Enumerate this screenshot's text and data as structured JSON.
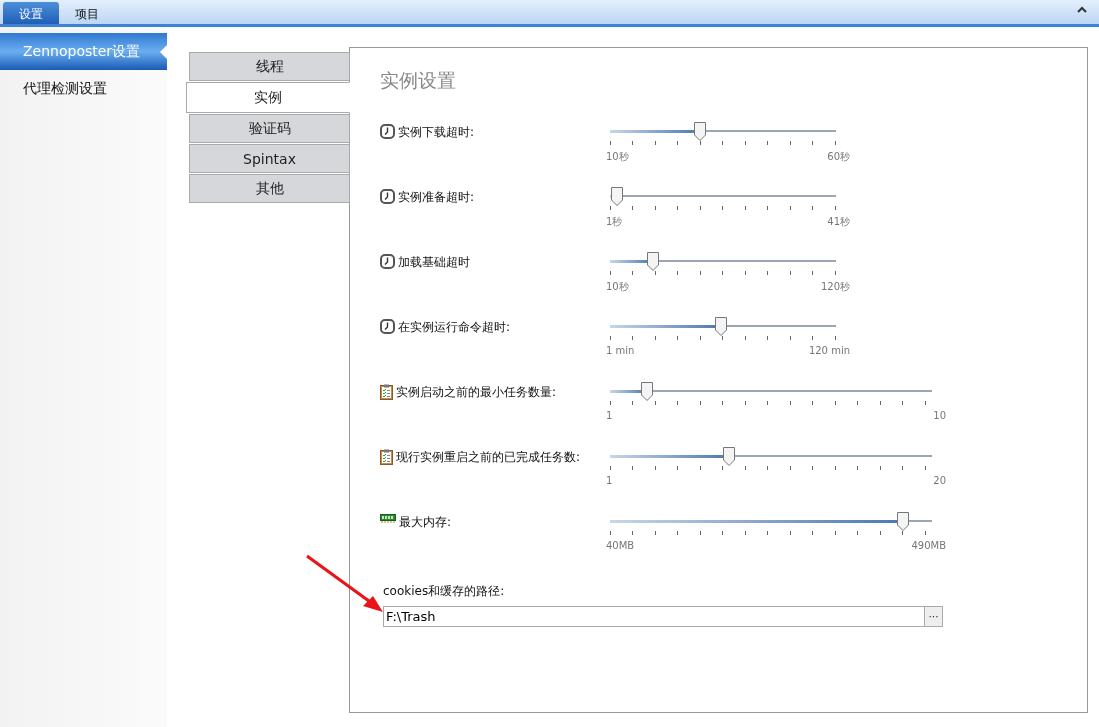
{
  "top_tabs": [
    {
      "label": "设置",
      "selected": true
    },
    {
      "label": "项目",
      "selected": false
    }
  ],
  "sidebar": {
    "items": [
      {
        "label": "Zennoposter设置",
        "selected": true
      },
      {
        "label": "代理检测设置",
        "selected": false
      }
    ]
  },
  "vertical_tabs": [
    {
      "label": "线程",
      "selected": false
    },
    {
      "label": "实例",
      "selected": true
    },
    {
      "label": "验证码",
      "selected": false
    },
    {
      "label": "Spintax",
      "selected": false
    },
    {
      "label": "其他",
      "selected": false
    }
  ],
  "panel": {
    "title": "实例设置",
    "sliders": [
      {
        "kind": "clock",
        "label": "实例下载超时:",
        "level": 0.4,
        "min": "10秒",
        "max": "60秒"
      },
      {
        "kind": "clock",
        "label": "实例准备超时:",
        "level": 0.03,
        "min": "1秒",
        "max": "41秒"
      },
      {
        "kind": "clock",
        "label": "加载基础超时",
        "level": 0.19,
        "min": "10秒",
        "max": "120秒"
      },
      {
        "kind": "clock",
        "label": "在实例运行命令超时:",
        "level": 0.49,
        "min": "1 min",
        "max": "120 min"
      },
      {
        "kind": "clipboard",
        "label": "实例启动之前的最小任务数量:",
        "level": 0.115,
        "min": "1",
        "max": "10"
      },
      {
        "kind": "clipboard",
        "label": "现行实例重启之前的已完成任务数:",
        "level": 0.37,
        "min": "1",
        "max": "20"
      },
      {
        "kind": "memory",
        "label": "最大内存:",
        "level": 0.91,
        "min": "40MB",
        "max": "490MB"
      }
    ],
    "path_label": "cookies和缓存的路径:",
    "path_value": "F:\\Trash",
    "browse_button": "···"
  }
}
